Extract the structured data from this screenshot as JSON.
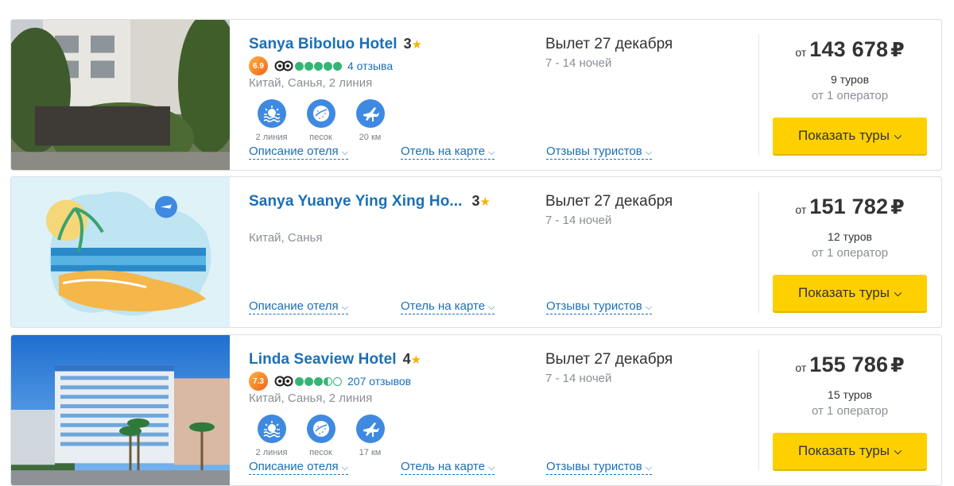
{
  "hotels": [
    {
      "name": "Sanya Biboluo Hotel",
      "stars": "3",
      "score": "6.9",
      "bubbles": [
        "full",
        "full",
        "full",
        "full",
        "full"
      ],
      "reviews": "4 отзыва",
      "location": "Китай, Санья, 2 линия",
      "features": [
        {
          "icon": "beach-line-icon",
          "label": "2 линия"
        },
        {
          "icon": "sand-icon",
          "label": "песок"
        },
        {
          "icon": "airport-distance-icon",
          "label": "20 км"
        }
      ],
      "links": {
        "description": "Описание отеля",
        "map": "Отель на карте",
        "reviews": "Отзывы туристов"
      },
      "depart": "Вылет 27 декабря",
      "nights": "7 - 14 ночей",
      "price_from": "от",
      "price": "143 678",
      "currency": "₽",
      "tours": "9 туров",
      "operators": "от 1 оператор",
      "button": "Показать туры"
    },
    {
      "name": "Sanya Yuanye Ying Xing Ho...",
      "stars": "3",
      "location": "Китай, Санья",
      "links": {
        "description": "Описание отеля",
        "map": "Отель на карте",
        "reviews": "Отзывы туристов"
      },
      "depart": "Вылет 27 декабря",
      "nights": "7 - 14 ночей",
      "price_from": "от",
      "price": "151 782",
      "currency": "₽",
      "tours": "12 туров",
      "operators": "от 1 оператор",
      "button": "Показать туры"
    },
    {
      "name": "Linda Seaview Hotel",
      "stars": "4",
      "score": "7.3",
      "bubbles": [
        "full",
        "full",
        "full",
        "full",
        "empty"
      ],
      "reviews": "207 отзывов",
      "location": "Китай, Санья, 2 линия",
      "features": [
        {
          "icon": "beach-line-icon",
          "label": "2 линия"
        },
        {
          "icon": "sand-icon",
          "label": "песок"
        },
        {
          "icon": "airport-distance-icon",
          "label": "17 км"
        }
      ],
      "links": {
        "description": "Описание отеля",
        "map": "Отель на карте",
        "reviews": "Отзывы туристов"
      },
      "depart": "Вылет 27 декабря",
      "nights": "7 - 14 ночей",
      "price_from": "от",
      "price": "155 786",
      "currency": "₽",
      "tours": "15 туров",
      "operators": "от 1 оператор",
      "button": "Показать туры"
    }
  ],
  "colors": {
    "link": "#1a6fb8",
    "button": "#ffd000",
    "feature": "#3f8ae0",
    "rating": "#34b575",
    "star": "#f5b400"
  }
}
